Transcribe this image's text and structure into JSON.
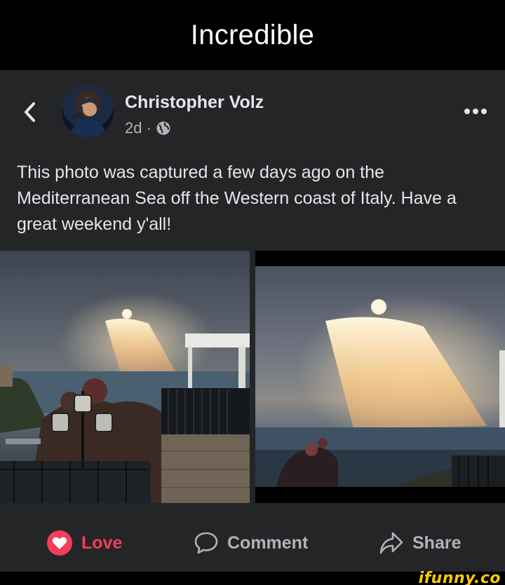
{
  "meme_title": "Incredible",
  "post": {
    "author": "Christopher Volz",
    "age": "2d",
    "separator": "·",
    "text": "This photo was captured a few days ago on the Mediterranean Sea off the Western coast of Italy. Have a great weekend y'all!"
  },
  "actions": {
    "love": "Love",
    "comment": "Comment",
    "share": "Share"
  },
  "watermark": "ifunny.co",
  "colors": {
    "background": "#242526",
    "love_red": "#f33e58",
    "muted": "#b0b3b8",
    "watermark": "#ffcc00"
  },
  "icons": [
    "back-chevron-icon",
    "globe-icon",
    "more-dots-icon",
    "love-reaction-icon",
    "comment-icon",
    "share-icon"
  ]
}
